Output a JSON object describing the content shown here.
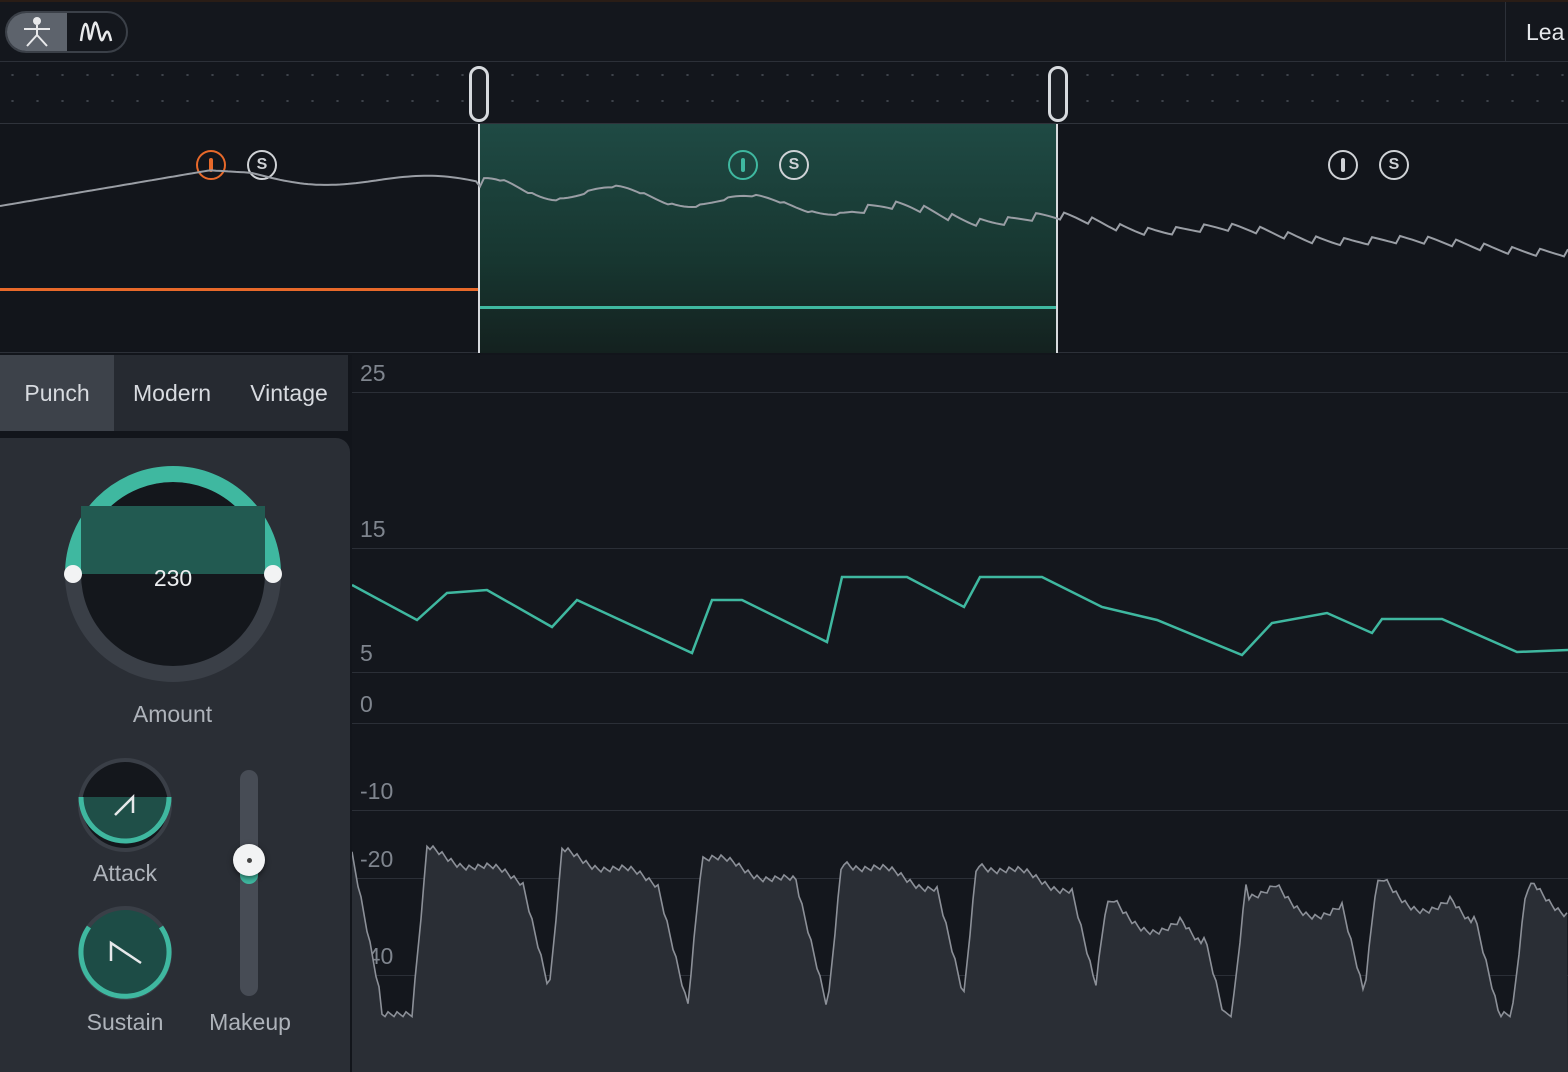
{
  "header": {
    "mode_buttons": [
      {
        "icon": "figure-icon",
        "active": true
      },
      {
        "icon": "waveform-icon",
        "active": false
      }
    ],
    "right_label": "Lea"
  },
  "bands": [
    {
      "index": 1,
      "color": "#e8692a",
      "icons": {
        "individual": "I",
        "solo": "S"
      }
    },
    {
      "index": 2,
      "color": "#3fb8a0",
      "selected": true,
      "icons": {
        "individual": "I",
        "solo": "S"
      }
    },
    {
      "index": 3,
      "color": "#cfd2d6",
      "icons": {
        "individual": "I",
        "solo": "S"
      }
    }
  ],
  "tabs": [
    {
      "label": "Punch",
      "active": true
    },
    {
      "label": "Modern",
      "active": false
    },
    {
      "label": "Vintage",
      "active": false
    }
  ],
  "controls": {
    "amount": {
      "label": "Amount",
      "value": "230"
    },
    "attack": {
      "label": "Attack"
    },
    "sustain": {
      "label": "Sustain"
    },
    "makeup": {
      "label": "Makeup",
      "level": 0.6
    }
  },
  "graph": {
    "ticks": [
      "25",
      "15",
      "5",
      "0",
      "-10",
      "-20",
      "-40"
    ]
  },
  "colors": {
    "accent": "#3fb8a0",
    "band1": "#e8692a",
    "bg": "#14171d",
    "panel": "#2a2e35"
  }
}
